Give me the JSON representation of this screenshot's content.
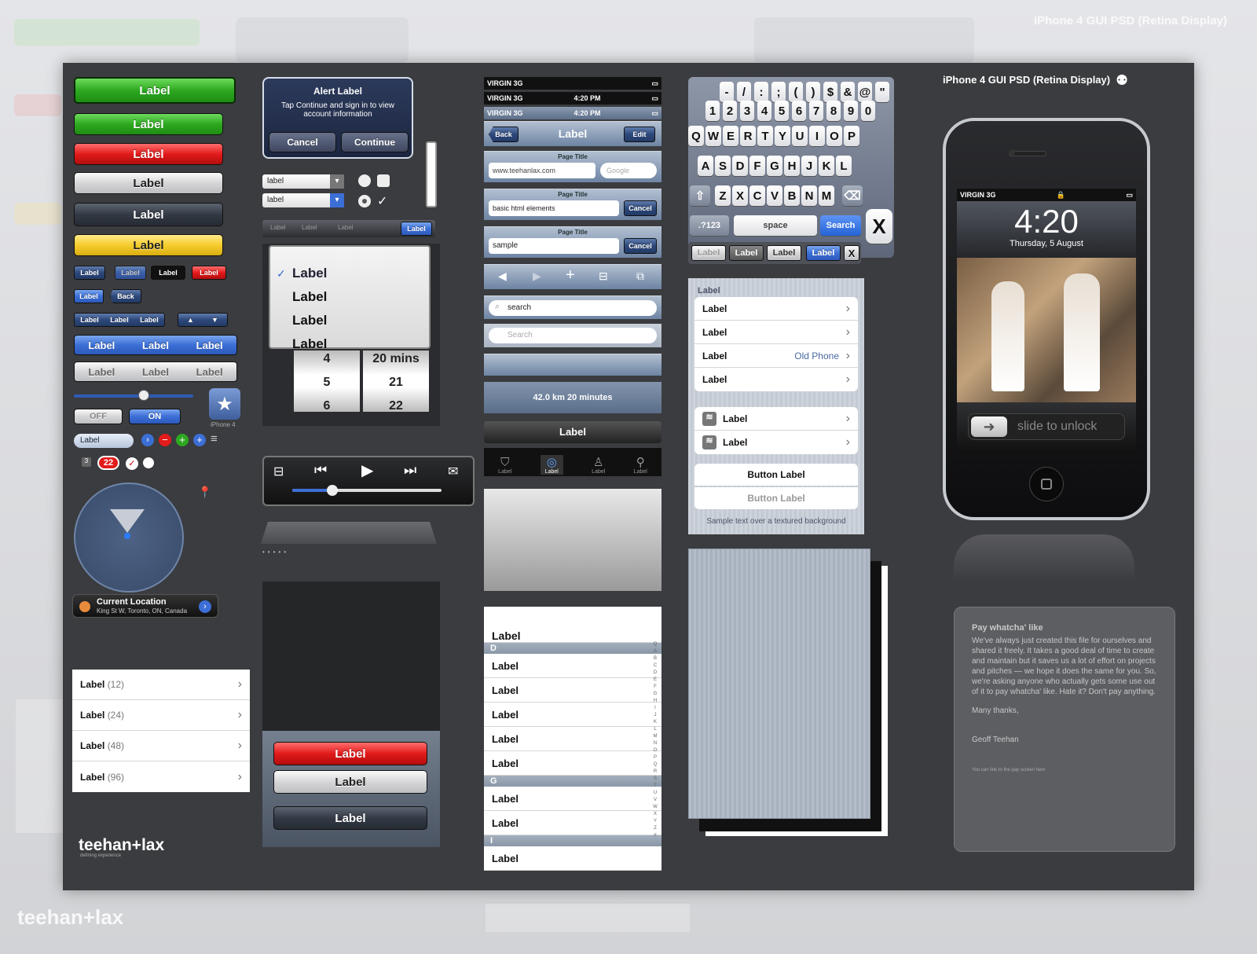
{
  "header": {
    "title": "iPhone 4 GUI PSD (Retina Display)",
    "brand": "teehan+lax",
    "brand_tagline": "defining experience"
  },
  "buttons": {
    "big_green": "Label",
    "green": "Label",
    "red": "Label",
    "silver": "Label",
    "dark": "Label",
    "yellow": "Label",
    "small": "Label",
    "back": "Back",
    "iphone4": "iPhone 4",
    "off": "OFF",
    "on": "ON"
  },
  "alert": {
    "title": "Alert Label",
    "message": "Tap Continue and sign in to view account information",
    "cancel": "Cancel",
    "continue": "Continue"
  },
  "selects": {
    "a": "label",
    "b": "label"
  },
  "picker": {
    "items": [
      "Label",
      "Label",
      "Label",
      "Label"
    ],
    "numbers_left": [
      "4",
      "5",
      "6"
    ],
    "numbers_right": [
      "20 mins",
      "21",
      "22"
    ]
  },
  "status_bar": {
    "carrier": "VIRGIN",
    "network": "3G",
    "time": "4:20 PM"
  },
  "navbar": {
    "back": "Back",
    "title": "Label",
    "edit": "Edit"
  },
  "url_bar": {
    "page_title": "Page Title",
    "url": "www.teehanlax.com",
    "google": "Google",
    "query1": "basic html elements",
    "query2": "sample",
    "cancel": "Cancel"
  },
  "search": {
    "value": "search",
    "placeholder": "Search"
  },
  "map_info": {
    "distance": "42.0 km 20 minutes",
    "label": "Label"
  },
  "tabbar": {
    "items": [
      "Label",
      "Label",
      "Label",
      "Label"
    ]
  },
  "indexed_list": {
    "sections": [
      {
        "letter": "D",
        "rows": [
          "Label",
          "Label",
          "Label",
          "Label",
          "Label"
        ]
      },
      {
        "letter": "G",
        "rows": [
          "Label",
          "Label"
        ]
      },
      {
        "letter": "I",
        "rows": [
          "Label"
        ]
      }
    ],
    "first": "Label",
    "index": [
      "Q",
      "A",
      "B",
      "C",
      "D",
      "E",
      "F",
      "G",
      "H",
      "I",
      "J",
      "K",
      "L",
      "M",
      "N",
      "O",
      "P",
      "Q",
      "R",
      "S",
      "T",
      "U",
      "V",
      "W",
      "X",
      "Y",
      "Z",
      "#"
    ]
  },
  "keyboard": {
    "row0": [
      "-",
      "/",
      ":",
      ";",
      "(",
      ")",
      "$",
      "&",
      "@",
      "\""
    ],
    "digits": [
      "1",
      "2",
      "3",
      "4",
      "5",
      "6",
      "7",
      "8",
      "9",
      "0"
    ],
    "row1": [
      "Q",
      "W",
      "E",
      "R",
      "T",
      "Y",
      "U",
      "I",
      "O",
      "P"
    ],
    "row2": [
      "A",
      "S",
      "D",
      "F",
      "G",
      "H",
      "J",
      "K",
      "L"
    ],
    "row3": [
      "Z",
      "X",
      "C",
      "V",
      "B",
      "N",
      "M"
    ],
    "alt": ".?123",
    "space": "space",
    "search": "Search",
    "x": "X"
  },
  "segment_bar": {
    "items": [
      "Label",
      "Label",
      "Label",
      "Label"
    ],
    "x": "X"
  },
  "settings": {
    "header": "Label",
    "rows": [
      "Label",
      "Label",
      "Label",
      "Label"
    ],
    "detail": "Old Phone",
    "wifi_rows": [
      "Label",
      "Label"
    ],
    "button": "Button Label",
    "button_disabled": "Button Label",
    "footer": "Sample text over a textured background"
  },
  "phone": {
    "carrier": "VIRGIN",
    "network": "3G",
    "time": "4:20",
    "date": "Thursday, 5 August",
    "slide": "slide to unlock"
  },
  "location": {
    "title": "Current Location",
    "address": "King St W, Toronto, ON, Canada"
  },
  "count_list": {
    "rows": [
      {
        "label": "Label",
        "count": "(12)"
      },
      {
        "label": "Label",
        "count": "(24)"
      },
      {
        "label": "Label",
        "count": "(48)"
      },
      {
        "label": "Label",
        "count": "(96)"
      }
    ]
  },
  "action_sheet": {
    "red": "Label",
    "silver": "Label",
    "dark": "Label"
  },
  "pay_note": {
    "title": "Pay whatcha' like",
    "body": "We've always just created this file for ourselves and shared it freely. It takes a good deal of time to create and maintain but it saves us a lot of effort on projects and pitches — we hope it does the same for you. So, we're asking anyone who actually gets some use out of it to pay whatcha' like. Hate it? Don't pay anything.",
    "thanks": "Many thanks,",
    "sign": "Geoff Teehan",
    "link_text": "You can link to the pay screen here"
  },
  "badges": {
    "count1": "3",
    "count2": "22"
  },
  "colors": {
    "panel_bg": "#3b3c3f",
    "accent_blue": "#3c6fd6",
    "green": "#2ea821",
    "red": "#e21b1b"
  }
}
